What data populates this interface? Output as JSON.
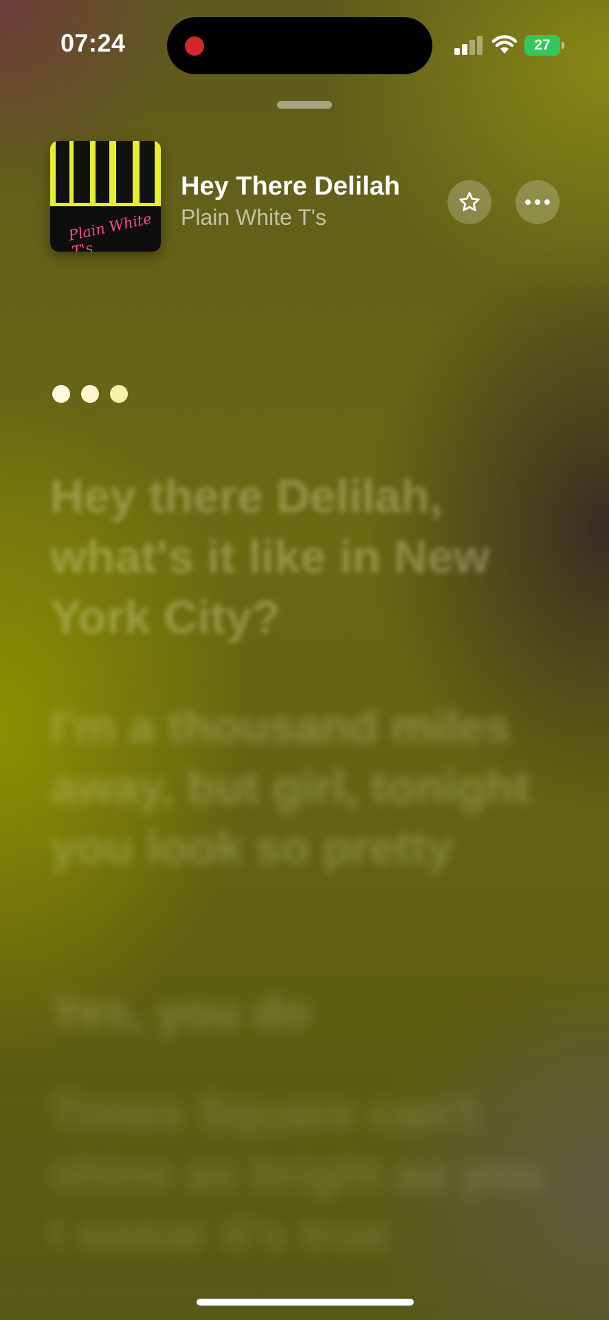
{
  "status_bar": {
    "time": "07:24",
    "battery": "27",
    "recording_indicator_color": "#d6262b",
    "battery_color": "#34c759"
  },
  "now_playing": {
    "title": "Hey There Delilah",
    "artist": "Plain White T's",
    "album_art_text": "Plain White T's"
  },
  "actions": {
    "favorite_icon": "star-icon",
    "more_icon": "ellipsis-icon"
  },
  "lyrics": {
    "lines": [
      "Hey there Delilah, what's it like in New York City?",
      "I'm a thousand miles away, but girl, tonight you look so pretty",
      "Yes, you do",
      "Times Square can't shine as bright as you I swear it's true"
    ]
  }
}
